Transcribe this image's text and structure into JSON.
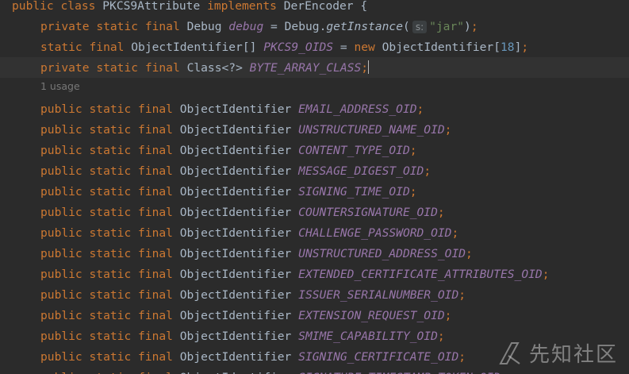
{
  "code": {
    "line1": {
      "k1": "public",
      "k2": "class",
      "name": "PKCS9Attribute",
      "k3": "implements",
      "iface": "DerEncoder",
      "brace": "{"
    },
    "line2": {
      "k1": "private",
      "k2": "static",
      "k3": "final",
      "type": "Debug",
      "field": "debug",
      "eq": "=",
      "cls": "Debug",
      "dot": ".",
      "method": "getInstance",
      "open": "(",
      "hint": "s:",
      "str": "\"jar\"",
      "close": ")",
      "semi": ";"
    },
    "line3": {
      "k1": "static",
      "k2": "final",
      "type": "ObjectIdentifier[]",
      "field": "PKCS9_OIDS",
      "eq": "=",
      "k3": "new",
      "cls": "ObjectIdentifier",
      "open": "[",
      "num": "18",
      "close": "]",
      "semi": ";"
    },
    "line4": {
      "k1": "private",
      "k2": "static",
      "k3": "final",
      "type": "Class<?>",
      "field": "BYTE_ARRAY_CLASS",
      "semi": ";"
    },
    "usage": "1 usage",
    "oid_decl": {
      "k1": "public",
      "k2": "static",
      "k3": "final",
      "type": "ObjectIdentifier",
      "semi": ";"
    },
    "oid_fields": [
      "EMAIL_ADDRESS_OID",
      "UNSTRUCTURED_NAME_OID",
      "CONTENT_TYPE_OID",
      "MESSAGE_DIGEST_OID",
      "SIGNING_TIME_OID",
      "COUNTERSIGNATURE_OID",
      "CHALLENGE_PASSWORD_OID",
      "UNSTRUCTURED_ADDRESS_OID",
      "EXTENDED_CERTIFICATE_ATTRIBUTES_OID",
      "ISSUER_SERIALNUMBER_OID",
      "EXTENSION_REQUEST_OID",
      "SMIME_CAPABILITY_OID",
      "SIGNING_CERTIFICATE_OID",
      "SIGNATURE_TIMESTAMP_TOKEN_OID"
    ]
  },
  "watermark": {
    "text": "先知社区"
  },
  "colors": {
    "background": "#2b2b2b",
    "keyword": "#cc7832",
    "field": "#9876aa",
    "number": "#6897bb",
    "string": "#6a8759",
    "plain": "#a9b7c6"
  }
}
